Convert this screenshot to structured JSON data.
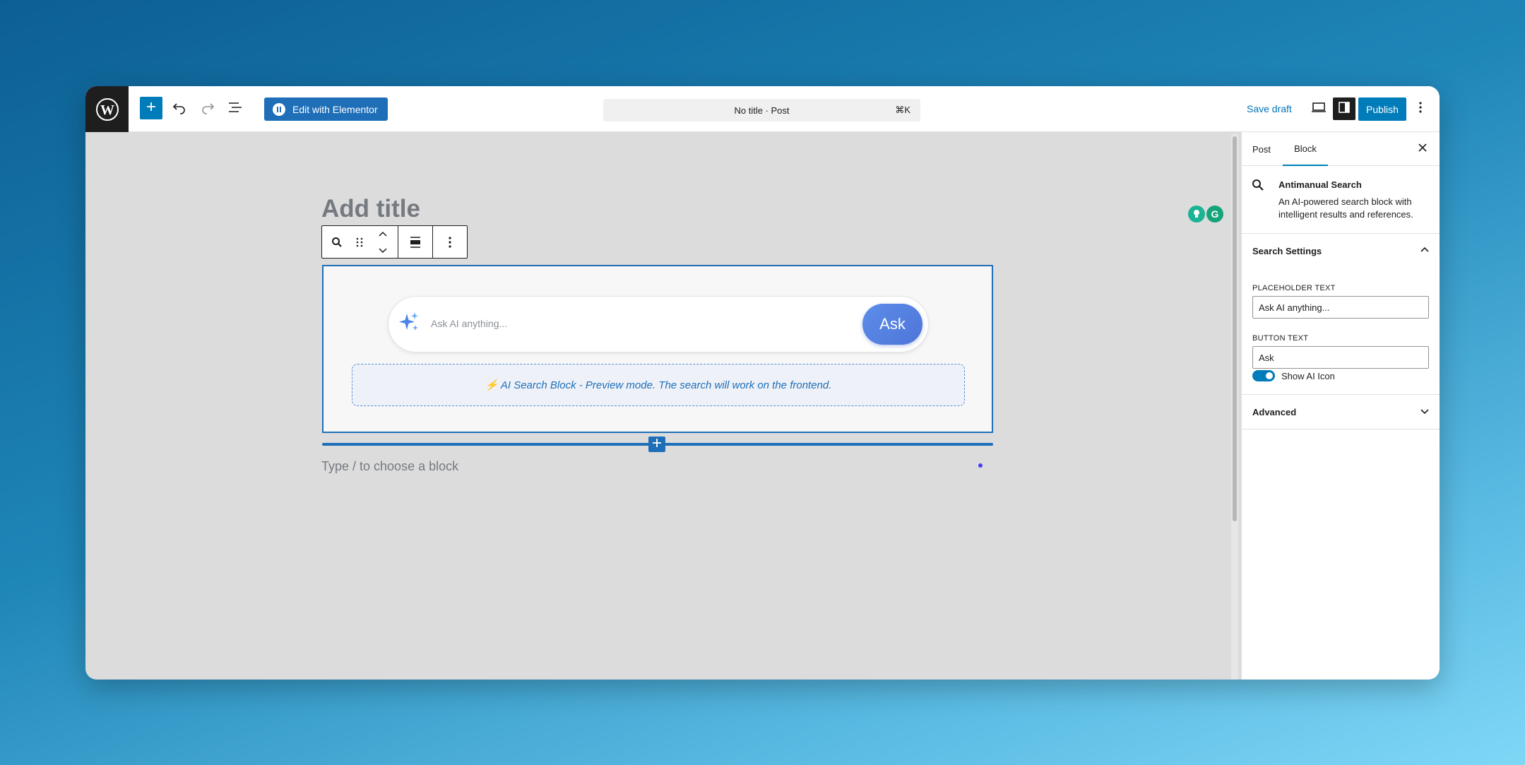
{
  "toolbar": {
    "edit_with_elementor_label": "Edit with Elementor",
    "command_bar_title": "No title · Post",
    "command_bar_shortcut": "⌘K",
    "save_draft_label": "Save draft",
    "publish_label": "Publish",
    "icons": [
      "wordpress-logo-icon",
      "plus-icon",
      "undo-icon",
      "redo-icon",
      "document-overview-icon",
      "elementor-icon",
      "desktop-view-icon",
      "sidebar-toggle-icon",
      "options-icon"
    ]
  },
  "editor": {
    "title_placeholder": "Add title",
    "block_toolbar_icons": [
      "search-icon",
      "drag-handle-icon",
      "move-up-icon",
      "move-down-icon",
      "align-icon",
      "more-options-icon"
    ],
    "ai_search": {
      "placeholder": "Ask AI anything...",
      "button_label": "Ask",
      "preview_note": "⚡ AI Search Block - Preview mode. The search will work on the frontend."
    },
    "block_hint": "Type / to choose a block"
  },
  "sidebar": {
    "tabs": [
      {
        "label": "Post",
        "active": false
      },
      {
        "label": "Block",
        "active": true
      }
    ],
    "block_card": {
      "title": "Antimanual Search",
      "description": "An AI-powered search block with intelligent results and references."
    },
    "search_settings": {
      "title": "Search Settings",
      "placeholder_label": "PLACEHOLDER TEXT",
      "placeholder_value": "Ask AI anything...",
      "button_label": "BUTTON TEXT",
      "button_value": "Ask",
      "show_ai_icon_label": "Show AI Icon",
      "show_ai_icon_enabled": true
    },
    "advanced_title": "Advanced"
  },
  "colors": {
    "accent": "#007cba",
    "block_border": "#1e6fb8",
    "ask_button": "#5c8de9",
    "canvas_bg": "#dcdcdc"
  }
}
